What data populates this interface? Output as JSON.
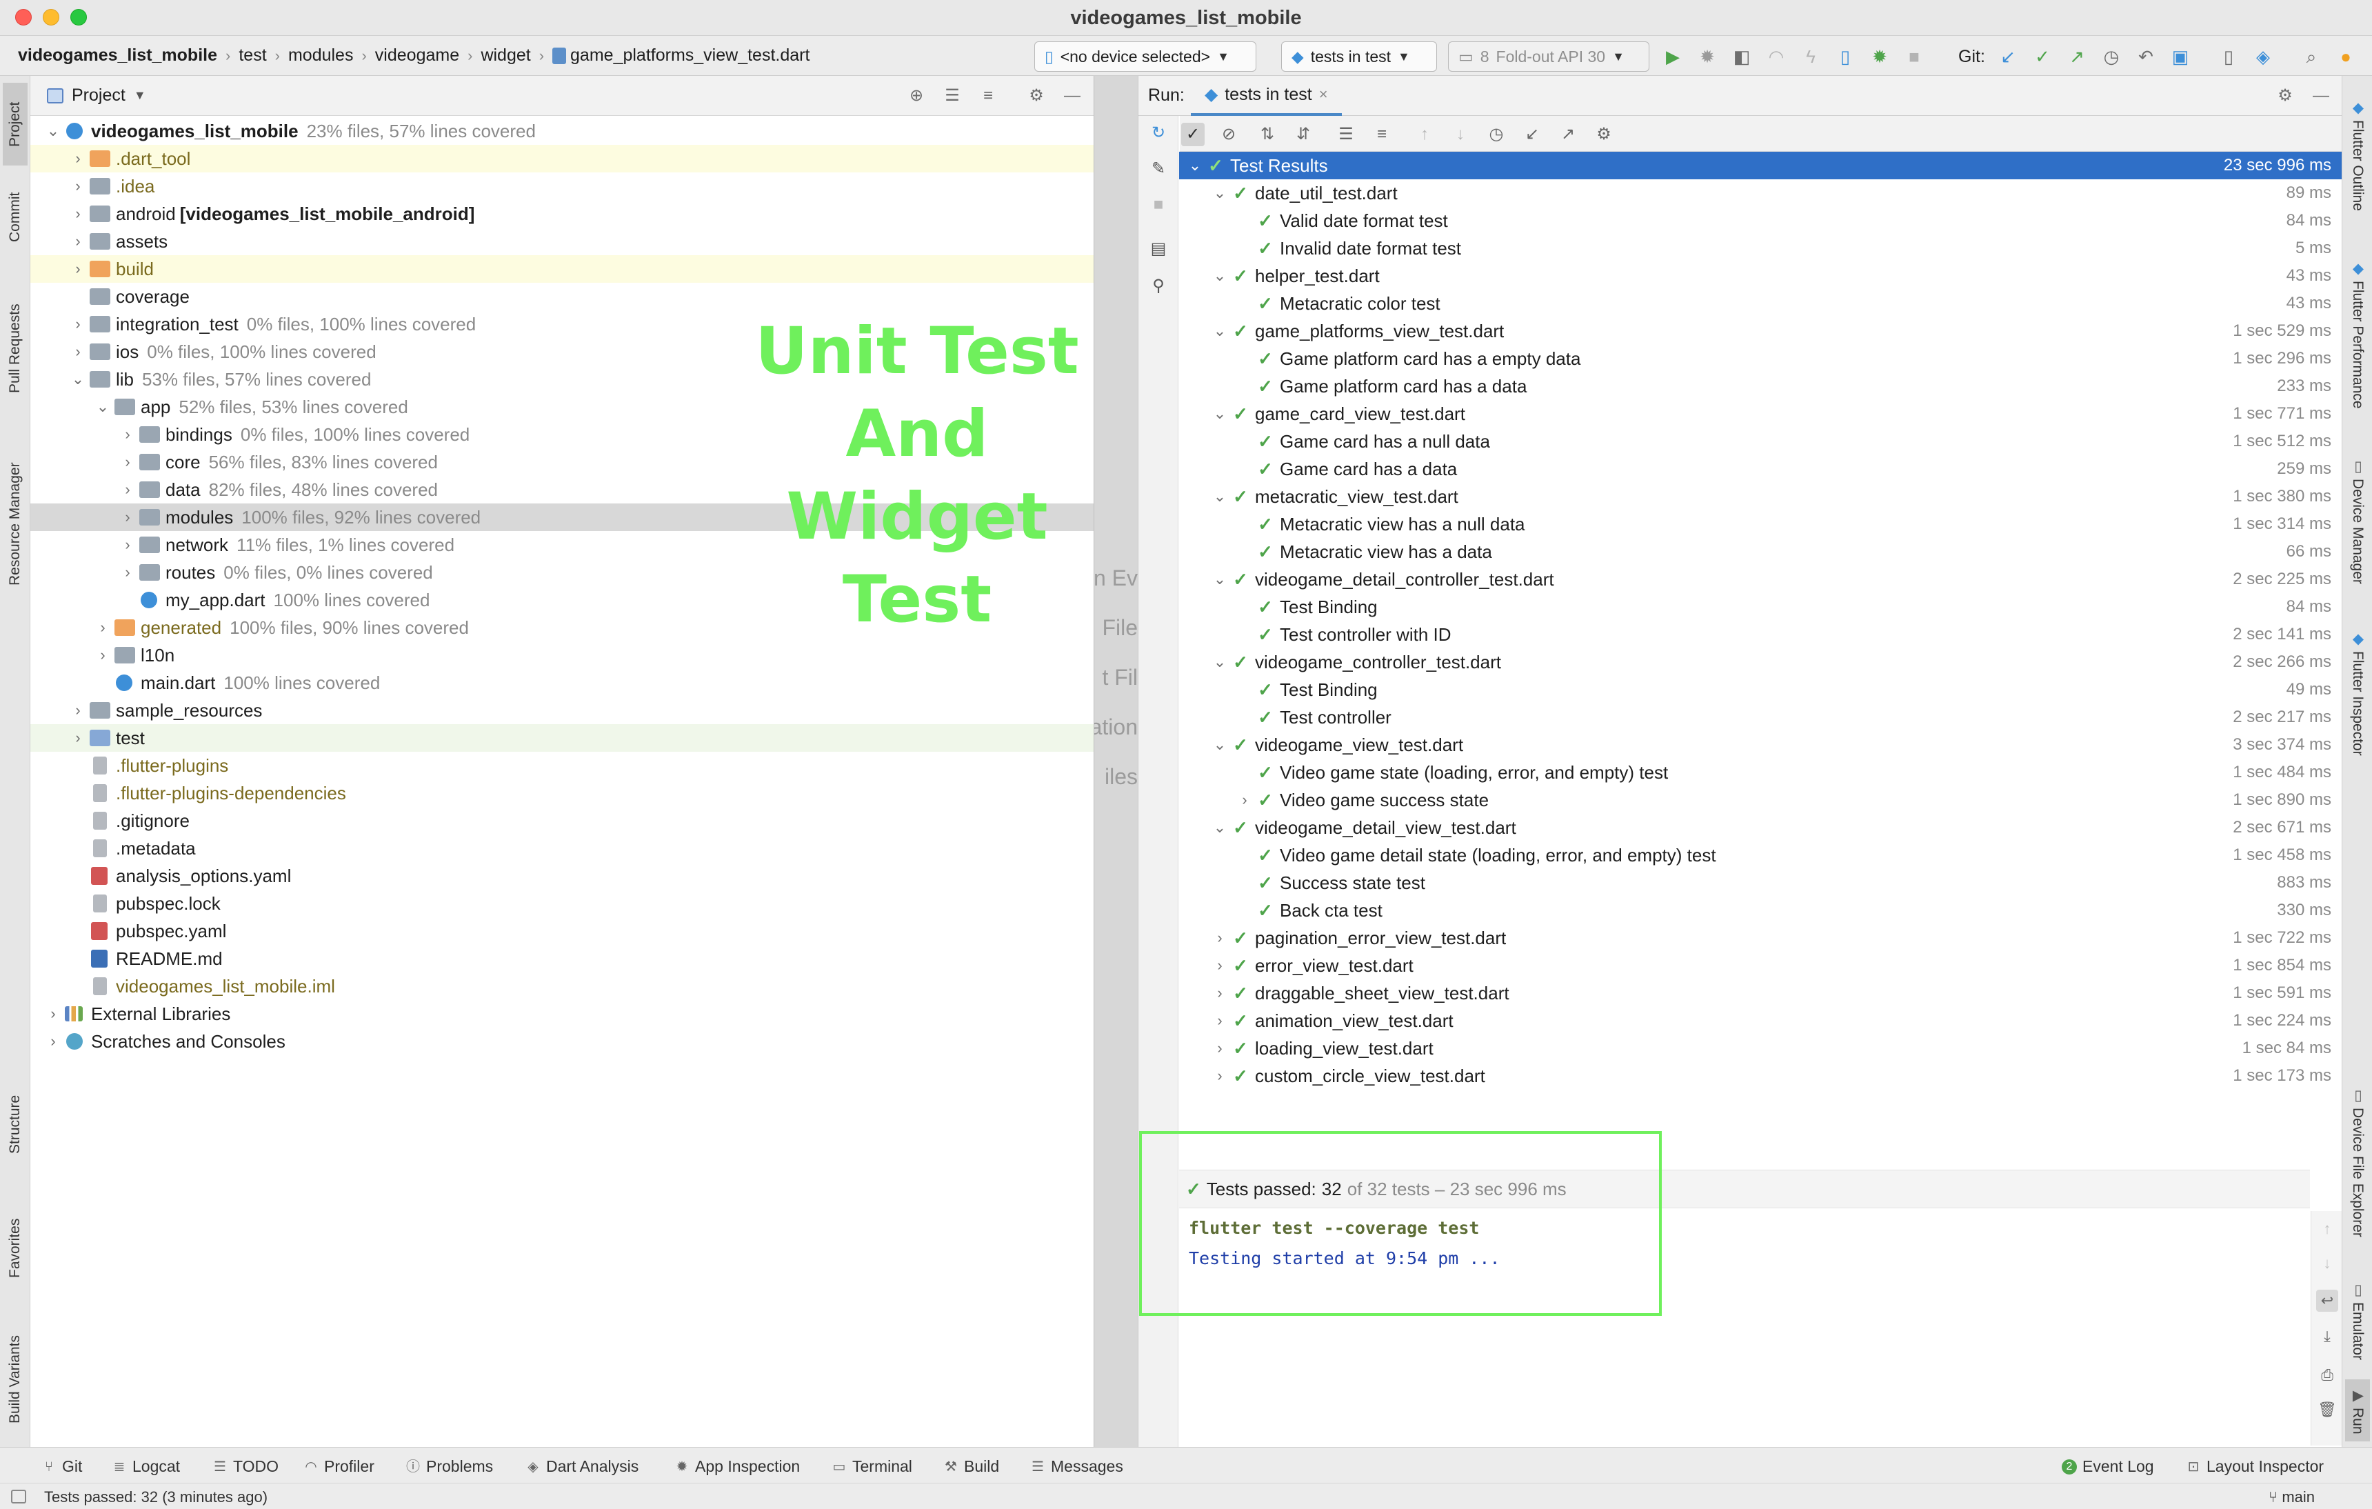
{
  "window": {
    "title": "videogames_list_mobile"
  },
  "breadcrumbs": [
    "videogames_list_mobile",
    "test",
    "modules",
    "videogame",
    "widget",
    "game_platforms_view_test.dart"
  ],
  "toolbar": {
    "device": "<no device selected>",
    "run_config": "tests in test",
    "emulator_num": "8",
    "emulator": "Fold-out API 30",
    "git_label": "Git:"
  },
  "left_tabs": [
    "Project",
    "Commit",
    "Pull Requests",
    "Resource Manager",
    "Structure",
    "Favorites",
    "Build Variants"
  ],
  "right_tabs": [
    "Flutter Outline",
    "Flutter Performance",
    "Device Manager",
    "Flutter Inspector",
    "Device File Explorer",
    "Emulator",
    "Run"
  ],
  "project": {
    "title": "Project",
    "tree": [
      {
        "name": "videogames_list_mobile",
        "meta": "23% files, 57% lines covered",
        "level": 0,
        "expanded": true,
        "icon": "flutter",
        "bold": true
      },
      {
        "name": ".dart_tool",
        "level": 1,
        "icon": "folder-orange",
        "olive": true,
        "hl": true
      },
      {
        "name": ".idea",
        "level": 1,
        "icon": "folder",
        "olive": true
      },
      {
        "name": "android",
        "suffix": "[videogames_list_mobile_android]",
        "level": 1,
        "icon": "folder"
      },
      {
        "name": "assets",
        "level": 1,
        "icon": "folder"
      },
      {
        "name": "build",
        "level": 1,
        "icon": "folder-orange",
        "olive": true,
        "hl": true
      },
      {
        "name": "coverage",
        "level": 1,
        "icon": "folder",
        "noarrow": true
      },
      {
        "name": "integration_test",
        "meta": "0% files, 100% lines covered",
        "level": 1,
        "icon": "folder"
      },
      {
        "name": "ios",
        "meta": "0% files, 100% lines covered",
        "level": 1,
        "icon": "folder"
      },
      {
        "name": "lib",
        "meta": "53% files, 57% lines covered",
        "level": 1,
        "icon": "folder",
        "expanded": true
      },
      {
        "name": "app",
        "meta": "52% files, 53% lines covered",
        "level": 2,
        "icon": "folder",
        "expanded": true
      },
      {
        "name": "bindings",
        "meta": "0% files, 100% lines covered",
        "level": 3,
        "icon": "folder"
      },
      {
        "name": "core",
        "meta": "56% files, 83% lines covered",
        "level": 3,
        "icon": "folder"
      },
      {
        "name": "data",
        "meta": "82% files, 48% lines covered",
        "level": 3,
        "icon": "folder"
      },
      {
        "name": "modules",
        "meta": "100% files, 92% lines covered",
        "level": 3,
        "icon": "folder",
        "sel": true
      },
      {
        "name": "network",
        "meta": "11% files, 1% lines covered",
        "level": 3,
        "icon": "folder"
      },
      {
        "name": "routes",
        "meta": "0% files, 0% lines covered",
        "level": 3,
        "icon": "folder"
      },
      {
        "name": "my_app.dart",
        "meta": "100% lines covered",
        "level": 3,
        "icon": "dart",
        "noarrow": true
      },
      {
        "name": "generated",
        "meta": "100% files, 90% lines covered",
        "level": 2,
        "icon": "folder-orange",
        "olive": true
      },
      {
        "name": "l10n",
        "level": 2,
        "icon": "folder"
      },
      {
        "name": "main.dart",
        "meta": "100% lines covered",
        "level": 2,
        "icon": "dart",
        "noarrow": true
      },
      {
        "name": "sample_resources",
        "level": 1,
        "icon": "folder"
      },
      {
        "name": "test",
        "level": 1,
        "icon": "folder-blue",
        "greenish": true
      },
      {
        "name": ".flutter-plugins",
        "level": 1,
        "icon": "file",
        "olive": true,
        "noarrow": true
      },
      {
        "name": ".flutter-plugins-dependencies",
        "level": 1,
        "icon": "file",
        "olive": true,
        "noarrow": true
      },
      {
        "name": ".gitignore",
        "level": 1,
        "icon": "file",
        "noarrow": true
      },
      {
        "name": ".metadata",
        "level": 1,
        "icon": "file",
        "noarrow": true
      },
      {
        "name": "analysis_options.yaml",
        "level": 1,
        "icon": "yml",
        "noarrow": true
      },
      {
        "name": "pubspec.lock",
        "level": 1,
        "icon": "file",
        "noarrow": true
      },
      {
        "name": "pubspec.yaml",
        "level": 1,
        "icon": "yml",
        "noarrow": true
      },
      {
        "name": "README.md",
        "level": 1,
        "icon": "md",
        "noarrow": true
      },
      {
        "name": "videogames_list_mobile.iml",
        "level": 1,
        "icon": "file",
        "olive": true,
        "noarrow": true
      },
      {
        "name": "External Libraries",
        "level": 0,
        "icon": "lib"
      },
      {
        "name": "Scratches and Consoles",
        "level": 0,
        "icon": "scratch"
      }
    ]
  },
  "overlay": {
    "line1": "Unit Test",
    "line2": "And",
    "line3": "Widget Test"
  },
  "editor_ghost": [
    "n Ev",
    "File",
    "t Fil",
    "ation",
    "iles"
  ],
  "run": {
    "label": "Run:",
    "tab": "tests in test",
    "results": [
      {
        "name": "Test Results",
        "time": "23 sec 996 ms",
        "level": 0,
        "arrow": "down",
        "selected": true
      },
      {
        "name": "date_util_test.dart",
        "time": "89 ms",
        "level": 1,
        "arrow": "down"
      },
      {
        "name": "Valid date format test",
        "time": "84 ms",
        "level": 2
      },
      {
        "name": "Invalid date format test",
        "time": "5 ms",
        "level": 2
      },
      {
        "name": "helper_test.dart",
        "time": "43 ms",
        "level": 1,
        "arrow": "down"
      },
      {
        "name": "Metacratic color test",
        "time": "43 ms",
        "level": 2
      },
      {
        "name": "game_platforms_view_test.dart",
        "time": "1 sec 529 ms",
        "level": 1,
        "arrow": "down"
      },
      {
        "name": "Game platform card has a empty data",
        "time": "1 sec 296 ms",
        "level": 2
      },
      {
        "name": "Game platform card has a data",
        "time": "233 ms",
        "level": 2
      },
      {
        "name": "game_card_view_test.dart",
        "time": "1 sec 771 ms",
        "level": 1,
        "arrow": "down"
      },
      {
        "name": "Game card has a null data",
        "time": "1 sec 512 ms",
        "level": 2
      },
      {
        "name": "Game card has a data",
        "time": "259 ms",
        "level": 2
      },
      {
        "name": "metacratic_view_test.dart",
        "time": "1 sec 380 ms",
        "level": 1,
        "arrow": "down"
      },
      {
        "name": "Metacratic view has a null data",
        "time": "1 sec 314 ms",
        "level": 2
      },
      {
        "name": "Metacratic view has a data",
        "time": "66 ms",
        "level": 2
      },
      {
        "name": "videogame_detail_controller_test.dart",
        "time": "2 sec 225 ms",
        "level": 1,
        "arrow": "down"
      },
      {
        "name": "Test Binding",
        "time": "84 ms",
        "level": 2
      },
      {
        "name": "Test controller with ID",
        "time": "2 sec 141 ms",
        "level": 2
      },
      {
        "name": "videogame_controller_test.dart",
        "time": "2 sec 266 ms",
        "level": 1,
        "arrow": "down"
      },
      {
        "name": "Test Binding",
        "time": "49 ms",
        "level": 2
      },
      {
        "name": "Test controller",
        "time": "2 sec 217 ms",
        "level": 2
      },
      {
        "name": "videogame_view_test.dart",
        "time": "3 sec 374 ms",
        "level": 1,
        "arrow": "down"
      },
      {
        "name": "Video game state (loading, error, and empty) test",
        "time": "1 sec 484 ms",
        "level": 2
      },
      {
        "name": "Video game success state",
        "time": "1 sec 890 ms",
        "level": 2,
        "arrow": "right"
      },
      {
        "name": "videogame_detail_view_test.dart",
        "time": "2 sec 671 ms",
        "level": 1,
        "arrow": "down"
      },
      {
        "name": "Video game detail state (loading, error, and empty) test",
        "time": "1 sec 458 ms",
        "level": 2
      },
      {
        "name": "Success state test",
        "time": "883 ms",
        "level": 2
      },
      {
        "name": "Back cta test",
        "time": "330 ms",
        "level": 2
      },
      {
        "name": "pagination_error_view_test.dart",
        "time": "1 sec 722 ms",
        "level": 1,
        "arrow": "right"
      },
      {
        "name": "error_view_test.dart",
        "time": "1 sec 854 ms",
        "level": 1,
        "arrow": "right"
      },
      {
        "name": "draggable_sheet_view_test.dart",
        "time": "1 sec 591 ms",
        "level": 1,
        "arrow": "right"
      },
      {
        "name": "animation_view_test.dart",
        "time": "1 sec 224 ms",
        "level": 1,
        "arrow": "right"
      },
      {
        "name": "loading_view_test.dart",
        "time": "1 sec 84 ms",
        "level": 1,
        "arrow": "right"
      },
      {
        "name": "custom_circle_view_test.dart",
        "time": "1 sec 173 ms",
        "level": 1,
        "arrow": "right"
      }
    ],
    "passed_label": "Tests passed:",
    "passed_count": "32",
    "passed_suffix": "of 32 tests – 23 sec 996 ms",
    "command": "flutter test --coverage test",
    "started": "Testing started at 9:54 pm ..."
  },
  "bottom_tabs": [
    "Git",
    "Logcat",
    "TODO",
    "Profiler",
    "Problems",
    "Dart Analysis",
    "App Inspection",
    "Terminal",
    "Build",
    "Messages",
    "Event Log",
    "Layout Inspector"
  ],
  "status": {
    "text": "Tests passed: 32 (3 minutes ago)",
    "branch": "main"
  },
  "colors": {
    "overlay_green": "#6ff05c",
    "selection_blue": "#2f6fc7",
    "pass_green": "#4ea44a"
  }
}
